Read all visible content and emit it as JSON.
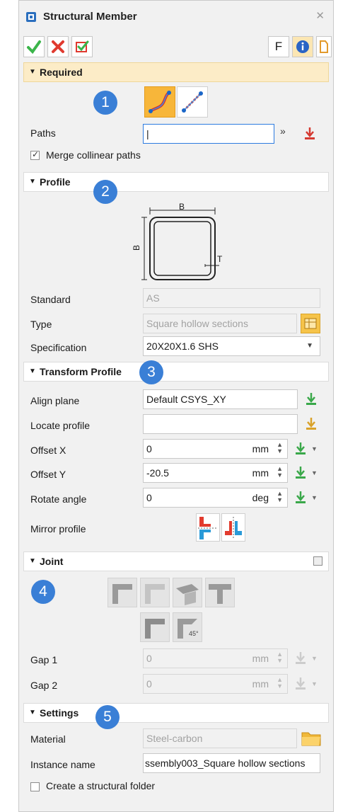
{
  "window": {
    "title": "Structural Member",
    "close_label": "✕"
  },
  "toolbar": {
    "f_label": "F"
  },
  "required": {
    "header": "Required",
    "badge": "1",
    "paths_label": "Paths",
    "paths_value": "|",
    "merge_label": "Merge collinear paths",
    "merge_checked": true
  },
  "profile": {
    "header": "Profile",
    "badge": "2",
    "diagram": {
      "b": "B",
      "h": "B",
      "t": "T"
    },
    "standard_label": "Standard",
    "standard_value": "AS",
    "type_label": "Type",
    "type_value": "Square hollow sections",
    "spec_label": "Specification",
    "spec_value": "20X20X1.6 SHS"
  },
  "transform": {
    "header": "Transform Profile",
    "badge": "3",
    "align_label": "Align plane",
    "align_value": "Default CSYS_XY",
    "locate_label": "Locate profile",
    "locate_value": "",
    "offx_label": "Offset X",
    "offx_value": "0",
    "offx_unit": "mm",
    "offy_label": "Offset Y",
    "offy_value": "-20.5",
    "offy_unit": "mm",
    "rot_label": "Rotate angle",
    "rot_value": "0",
    "rot_unit": "deg",
    "mirror_label": "Mirror profile"
  },
  "joint": {
    "header": "Joint",
    "badge": "4",
    "gap1_label": "Gap 1",
    "gap1_value": "0",
    "gap1_unit": "mm",
    "gap2_label": "Gap 2",
    "gap2_value": "0",
    "gap2_unit": "mm",
    "angle_text": "45°"
  },
  "settings": {
    "header": "Settings",
    "badge": "5",
    "material_label": "Material",
    "material_value": "Steel-carbon",
    "instance_label": "Instance name",
    "instance_value": "ssembly003_Square hollow sections",
    "folder_label": "Create a structural folder",
    "folder_checked": false
  },
  "colors": {
    "accent": "#3a7fd6",
    "required_bg": "#fcecc7",
    "ok_green": "#3bb54a",
    "cancel_red": "#e03a2f"
  }
}
